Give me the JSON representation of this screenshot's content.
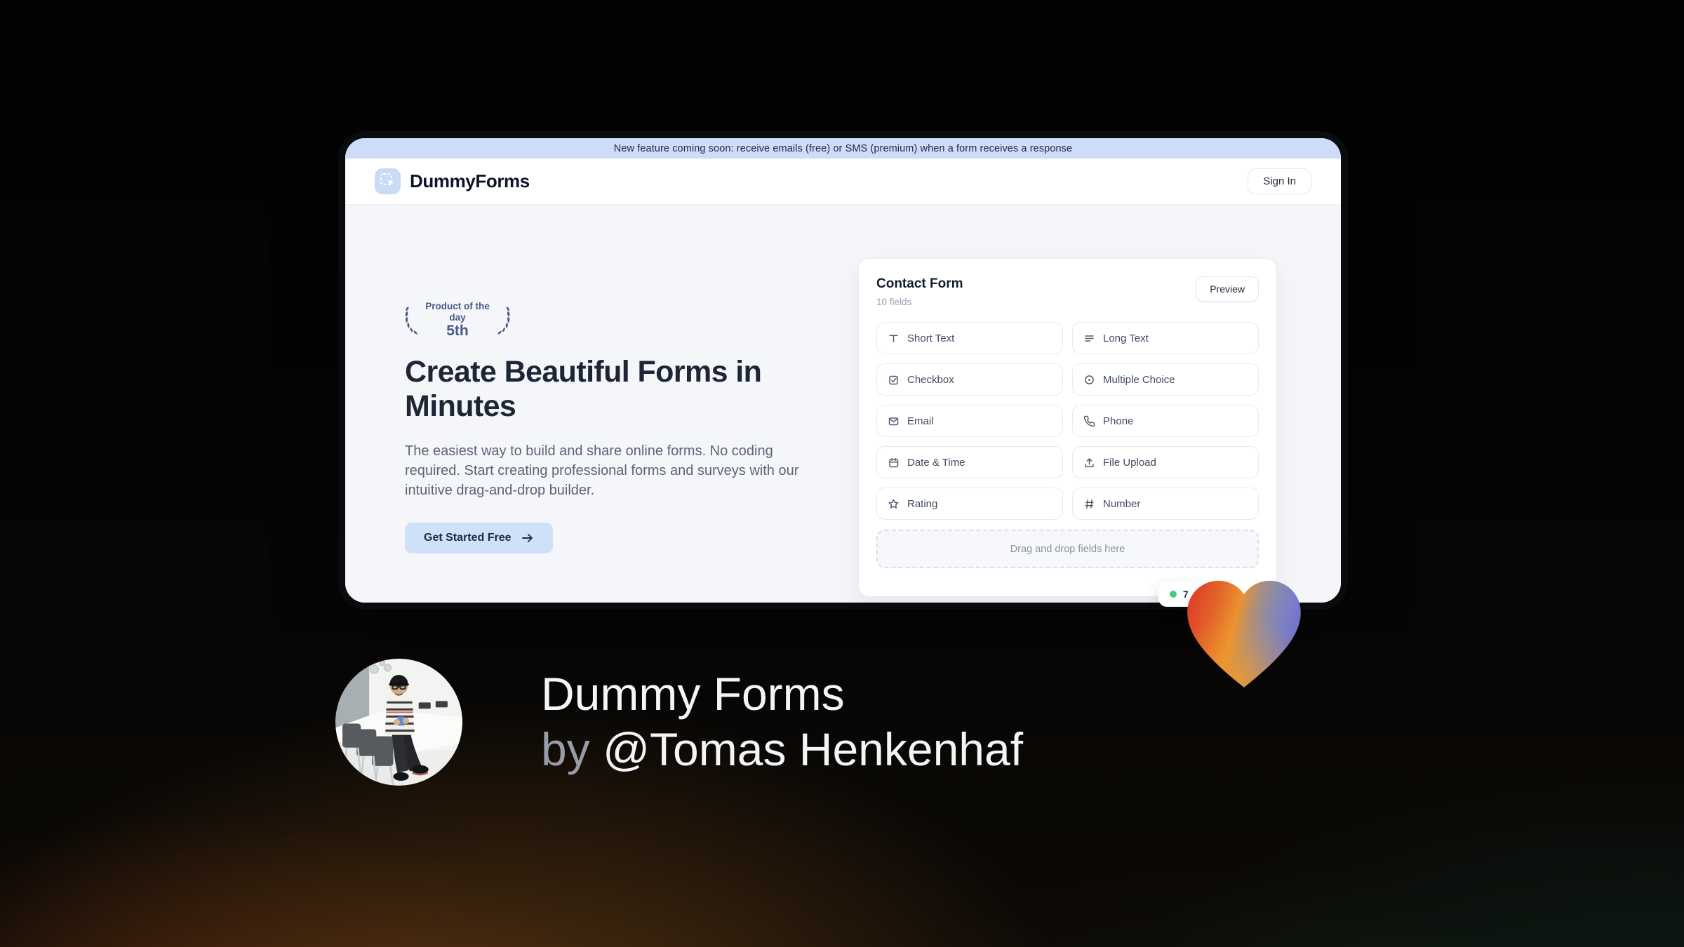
{
  "banner": {
    "text": "New feature coming soon: receive emails (free) or SMS (premium) when a form receives a response"
  },
  "header": {
    "brand": "DummyForms",
    "logo_icon": "dashed-select-cursor-icon",
    "sign_in_label": "Sign In"
  },
  "hero": {
    "award": {
      "icon": "laurel-wreath-icon",
      "top": "Product of the day",
      "rank": "5th"
    },
    "title": "Create Beautiful Forms in Minutes",
    "description": "The easiest way to build and share online forms. No coding required. Start creating professional forms and surveys with our intuitive drag-and-drop builder.",
    "cta": {
      "label": "Get Started Free",
      "icon": "arrow-right-icon"
    }
  },
  "form_card": {
    "title": "Contact Form",
    "subtitle": "10 fields",
    "preview_button": "Preview",
    "fields": [
      {
        "label": "Short Text",
        "icon": "text-icon"
      },
      {
        "label": "Long Text",
        "icon": "paragraph-lines-icon"
      },
      {
        "label": "Checkbox",
        "icon": "checkbox-icon"
      },
      {
        "label": "Multiple Choice",
        "icon": "radio-circle-icon"
      },
      {
        "label": "Email",
        "icon": "envelope-icon"
      },
      {
        "label": "Phone",
        "icon": "phone-icon"
      },
      {
        "label": "Date & Time",
        "icon": "calendar-icon"
      },
      {
        "label": "File Upload",
        "icon": "upload-icon"
      },
      {
        "label": "Rating",
        "icon": "star-icon"
      },
      {
        "label": "Number",
        "icon": "hash-icon"
      }
    ],
    "dropzone_text": "Drag and drop fields here"
  },
  "status_badge": {
    "text": "7",
    "dot_color": "#43ce7e"
  },
  "caption": {
    "title": "Dummy Forms",
    "by": "by",
    "author": "@Tomas Henkenhaf"
  },
  "colors": {
    "banner_bg": "#cddcf9",
    "accent_blue": "#cfe1f9",
    "navy": "#1d2637",
    "body_bg": "#f5f6f9",
    "heart_red": "#dc3a26",
    "heart_orange": "#ea9231",
    "heart_purple": "#7376c8",
    "live_dot_green": "#43ce7e"
  }
}
